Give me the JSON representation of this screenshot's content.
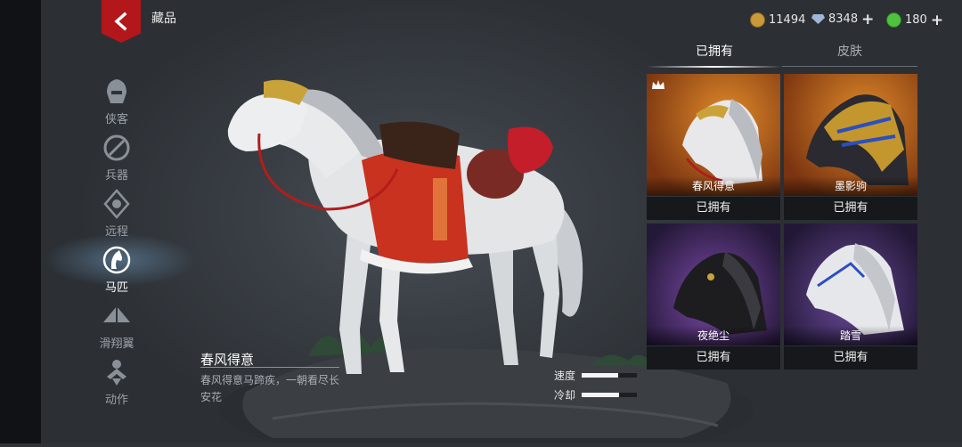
{
  "header": {
    "title": "藏品"
  },
  "currencies": [
    {
      "icon": "copper-coin-icon",
      "value": "11494",
      "color": "#c99a3a",
      "has_plus": false
    },
    {
      "icon": "diamond-icon",
      "value": "8348",
      "color": "#9fb6d8",
      "has_plus": true
    },
    {
      "icon": "jade-icon",
      "value": "180",
      "color": "#4fc23e",
      "has_plus": true
    }
  ],
  "side_nav": [
    {
      "label": "侠客",
      "icon": "hero-helmet-icon",
      "active": false
    },
    {
      "label": "兵器",
      "icon": "weapon-icon",
      "active": false
    },
    {
      "label": "远程",
      "icon": "ranged-icon",
      "active": false
    },
    {
      "label": "马匹",
      "icon": "horse-icon",
      "active": true
    },
    {
      "label": "滑翔翼",
      "icon": "glider-icon",
      "active": false
    },
    {
      "label": "动作",
      "icon": "action-icon",
      "active": false
    }
  ],
  "tabs": {
    "owned": "已拥有",
    "skins": "皮肤"
  },
  "cards": [
    {
      "name": "春风得意",
      "status": "已拥有",
      "theme": "orange",
      "horse": "white-red"
    },
    {
      "name": "墨影驹",
      "status": "已拥有",
      "theme": "orange",
      "horse": "armored"
    },
    {
      "name": "夜绝尘",
      "status": "已拥有",
      "theme": "purple",
      "horse": "black"
    },
    {
      "name": "踏雪",
      "status": "已拥有",
      "theme": "purple",
      "horse": "white-blue"
    }
  ],
  "selected": {
    "title": "春风得意",
    "description": "春风得意马蹄疾，一朝看尽长安花"
  },
  "stats": [
    {
      "label": "速度",
      "value": 0.66
    },
    {
      "label": "冷却",
      "value": 0.68
    }
  ],
  "colors": {
    "accent_red": "#b3161b",
    "orange_bg": "#c0681a",
    "purple_bg": "#3a2a5a"
  }
}
